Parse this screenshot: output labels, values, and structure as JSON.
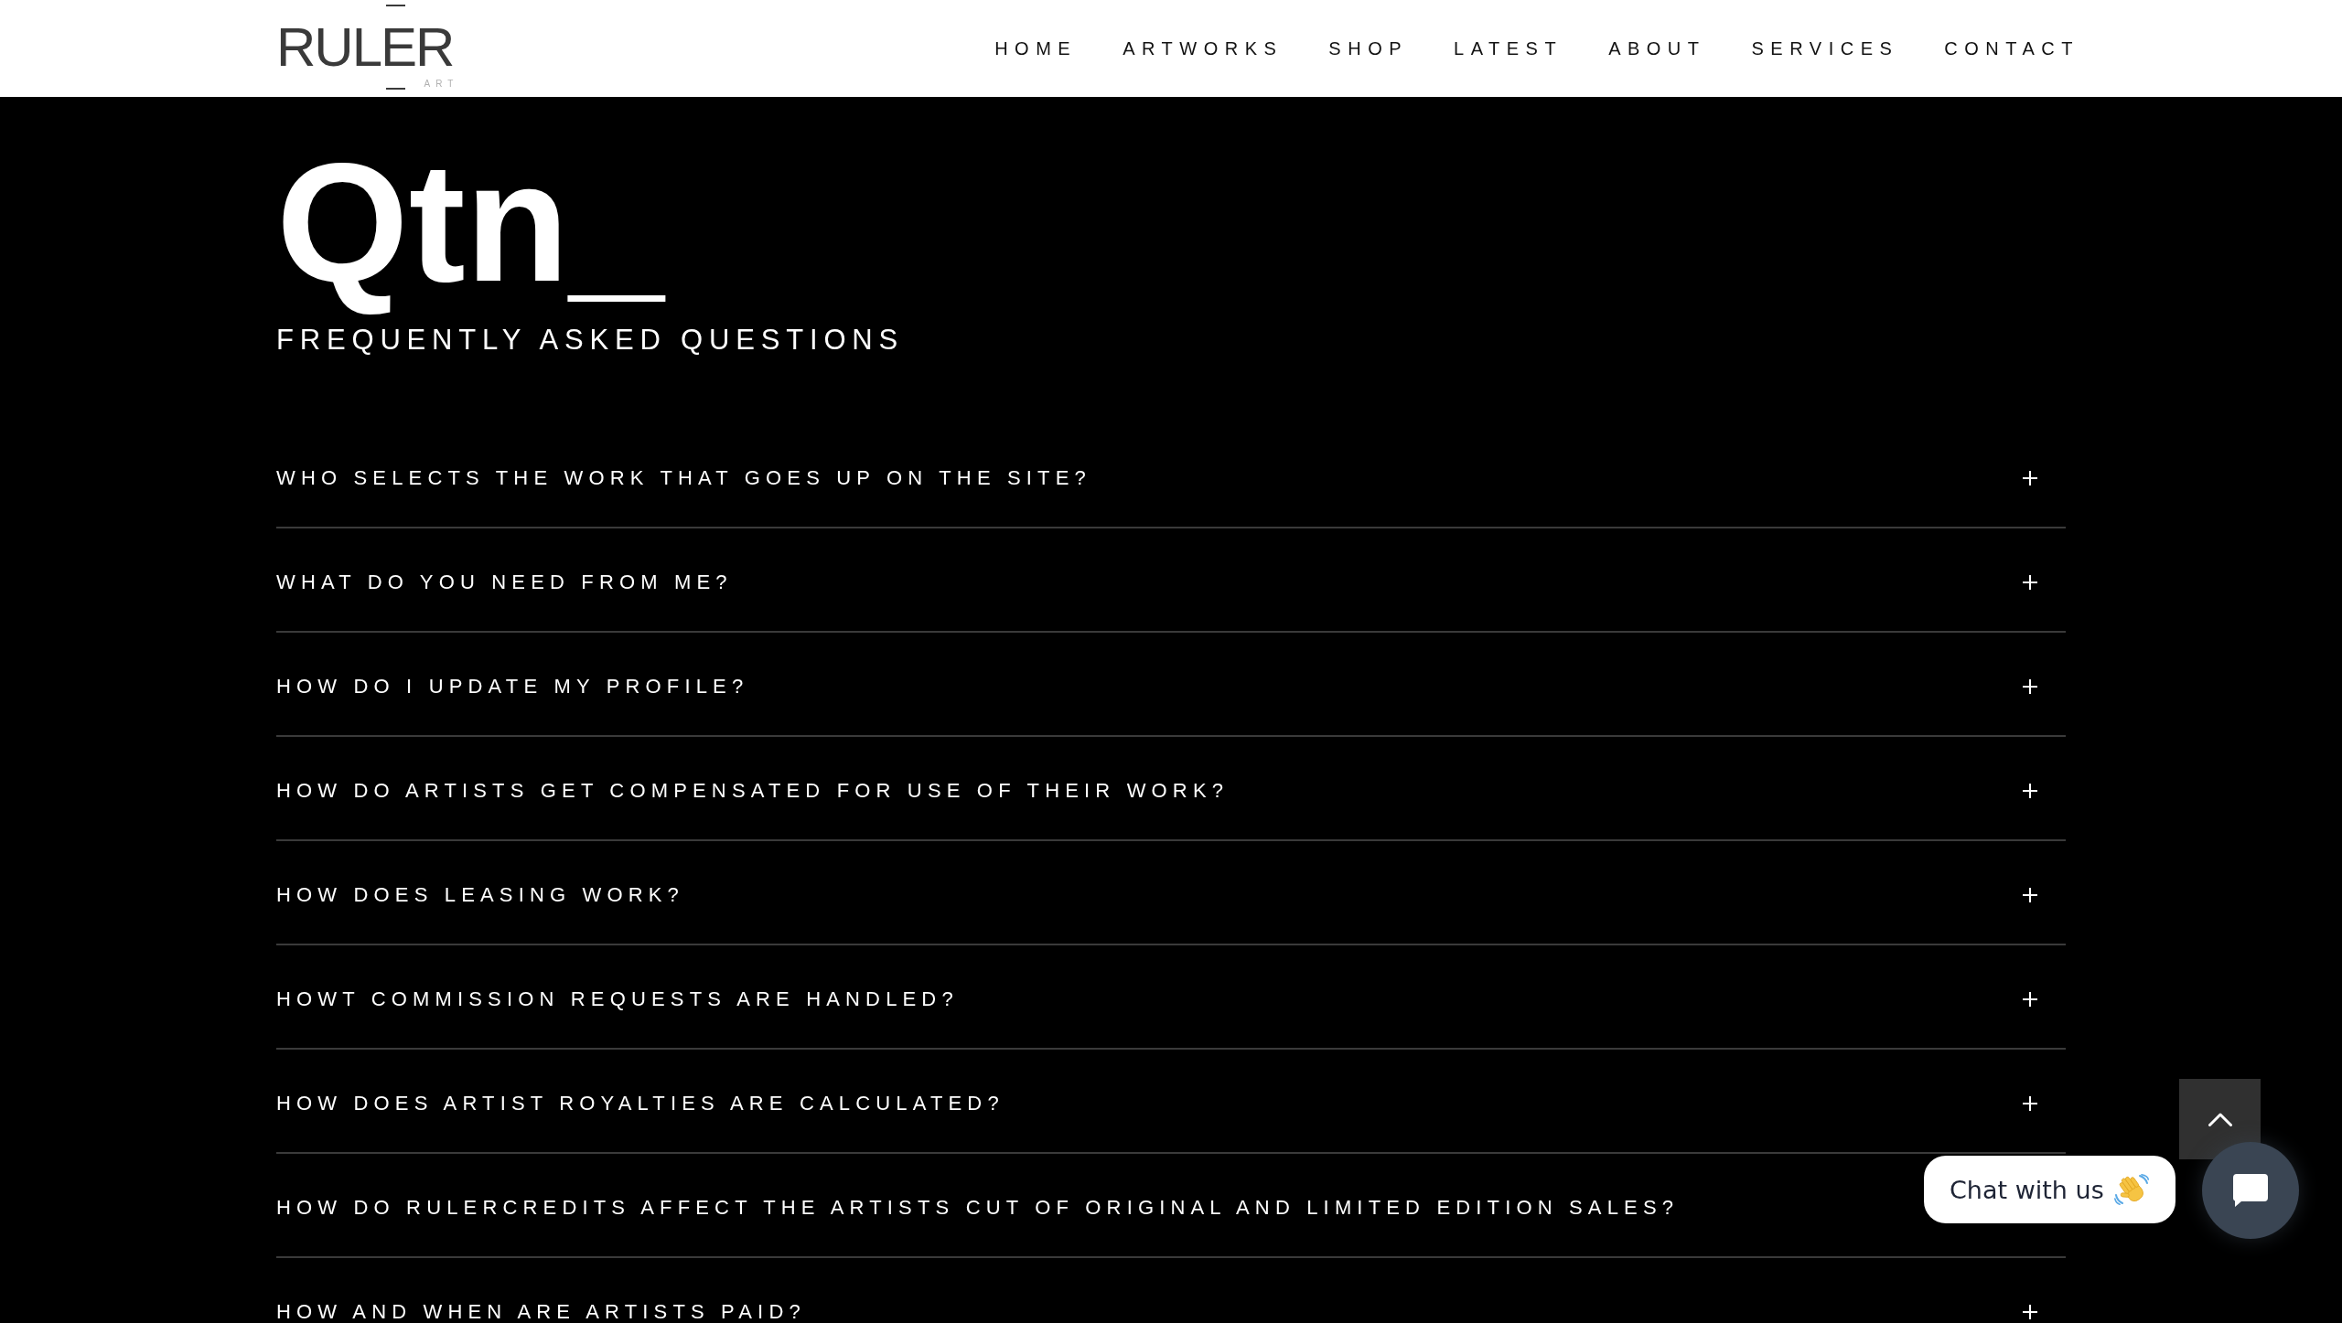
{
  "header": {
    "logo": {
      "wordmark": "RULER",
      "tagline": "ART"
    },
    "nav": [
      "HOME",
      "ARTWORKS",
      "SHOP",
      "LATEST",
      "ABOUT",
      "SERVICES",
      "CONTACT"
    ]
  },
  "hero": {
    "title": "Qtn_",
    "subtitle": "FREQUENTLY ASKED QUESTIONS"
  },
  "faq": [
    {
      "question": "WHO SELECTS THE WORK THAT GOES UP ON THE SITE?",
      "expanded": false
    },
    {
      "question": "WHAT DO YOU NEED FROM ME?",
      "expanded": false
    },
    {
      "question": "HOW DO I UPDATE MY PROFILE?",
      "expanded": false
    },
    {
      "question": "HOW DO ARTISTS GET COMPENSATED FOR USE OF THEIR WORK?",
      "expanded": false
    },
    {
      "question": "HOW DOES LEASING WORK?",
      "expanded": false
    },
    {
      "question": "HOWT COMMISSION REQUESTS ARE HANDLED?",
      "expanded": false
    },
    {
      "question": "HOW DOES ARTIST ROYALTIES ARE CALCULATED?",
      "expanded": false
    },
    {
      "question": "HOW DO RULERCREDITS AFFECT THE ARTISTS CUT OF ORIGINAL AND LIMITED EDITION SALES?"
    },
    {
      "question": "HOW AND WHEN ARE ARTISTS PAID?",
      "expanded": false
    }
  ],
  "chat_widget": {
    "prompt": "Chat with us"
  }
}
